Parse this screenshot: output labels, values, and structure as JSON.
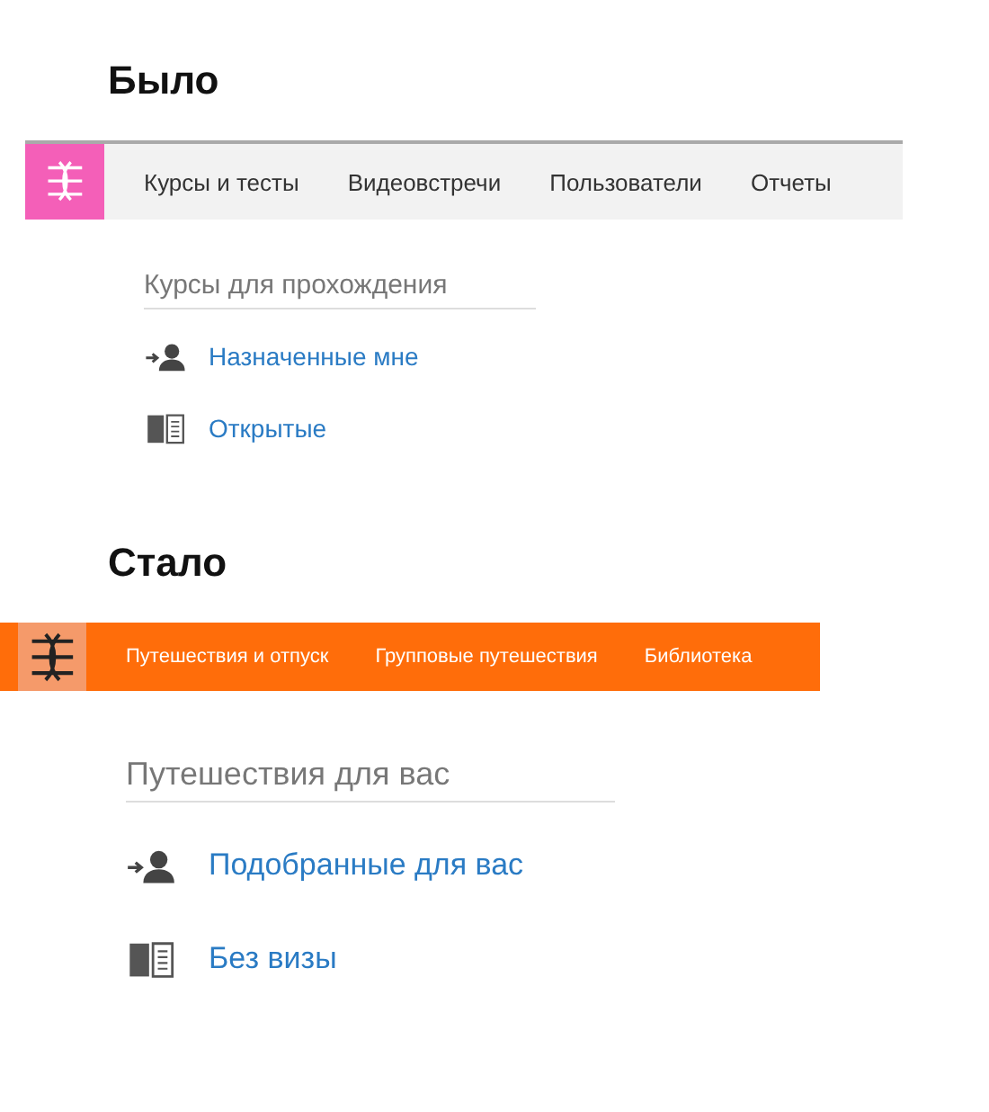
{
  "panels": [
    {
      "kind": "before",
      "title": "Было",
      "tabs": [
        "Курсы и тесты",
        "Видеовстречи",
        "Пользователи",
        "Отчеты"
      ],
      "section_title": "Курсы для прохождения",
      "links": [
        {
          "kind": "assigned",
          "label": "Назначенные мне"
        },
        {
          "kind": "book",
          "label": "Открытые"
        }
      ]
    },
    {
      "kind": "after",
      "title": "Стало",
      "tabs": [
        "Путешествия и отпуск",
        "Групповые путешествия",
        "Библиотека"
      ],
      "section_title": "Путешествия для вас",
      "links": [
        {
          "kind": "assigned",
          "label": "Подобранные для вас"
        },
        {
          "kind": "book",
          "label": "Без визы"
        }
      ]
    }
  ]
}
